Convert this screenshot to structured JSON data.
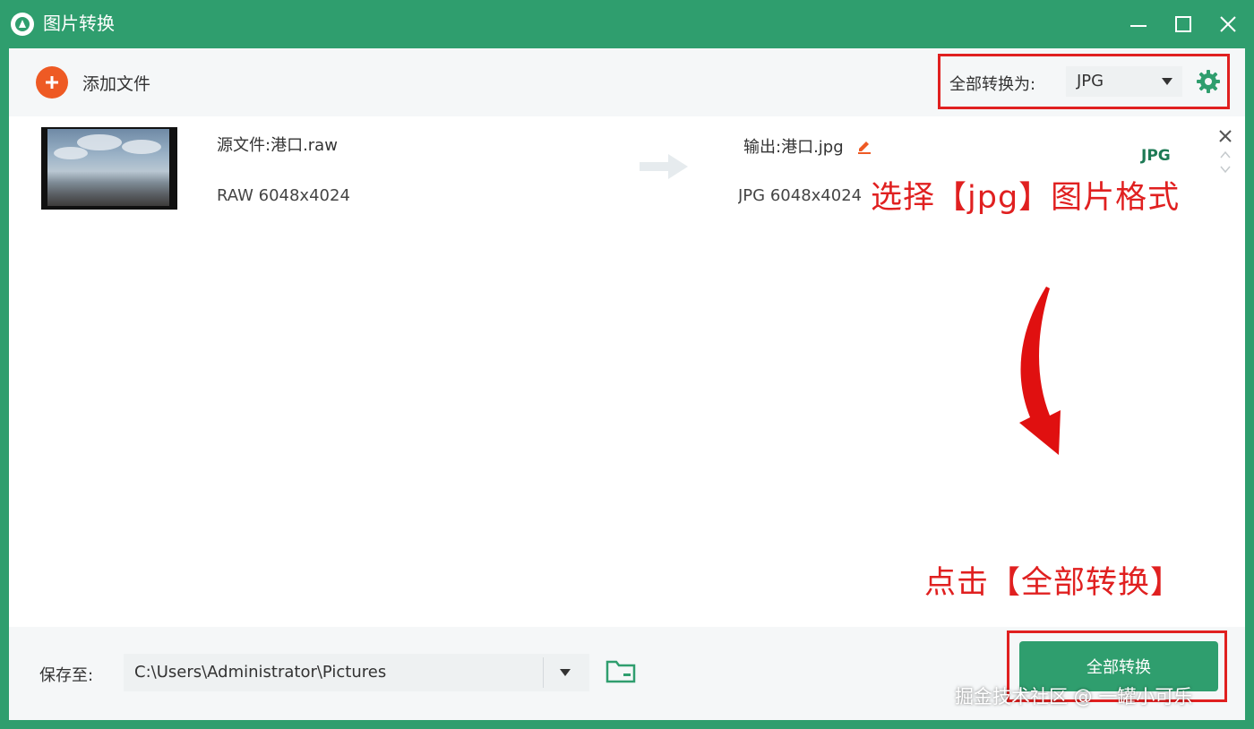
{
  "window": {
    "title": "图片转换"
  },
  "toolbar": {
    "add_files_label": "添加文件",
    "convert_all_to_label": "全部转换为:",
    "format_value": "JPG"
  },
  "file": {
    "source_name": "源文件:港口.raw",
    "source_meta": "RAW   6048x4024",
    "output_name": "输出:港口.jpg",
    "output_meta": "JPG   6048x4024",
    "output_format": "JPG"
  },
  "annotations": {
    "top": "选择【jpg】图片格式",
    "bottom": "点击【全部转换】"
  },
  "footer": {
    "save_to_label": "保存至:",
    "save_path": "C:\\Users\\Administrator\\Pictures",
    "convert_all_button": "全部转换"
  },
  "watermark": "掘金技术社区 @ 一罐小可乐",
  "colors": {
    "brand_green": "#2f9e6e",
    "accent_orange": "#ee5a24",
    "annotation_red": "#e02020"
  }
}
